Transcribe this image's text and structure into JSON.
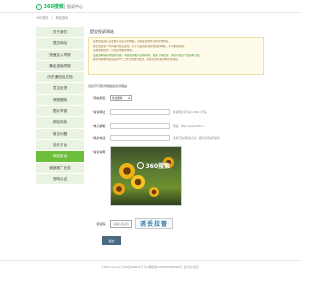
{
  "header": {
    "logo_text": "360搜索",
    "subtitle": "投诉中心"
  },
  "breadcrumb": [
    "360首页",
    "网站投诉"
  ],
  "sidebar": {
    "items": [
      {
        "label": "关于我们",
        "active": false
      },
      {
        "label": "提交网址",
        "active": false
      },
      {
        "label": "快速加入举报",
        "active": false
      },
      {
        "label": "暴走漫画举报",
        "active": false
      },
      {
        "label": "历史通知及文档",
        "active": false
      },
      {
        "label": "意见反馈",
        "active": false
      },
      {
        "label": "快照删除",
        "active": false
      },
      {
        "label": "图片举报",
        "active": false
      },
      {
        "label": "网站体检",
        "active": false
      },
      {
        "label": "常见问题",
        "active": false
      },
      {
        "label": "站长平台",
        "active": false
      },
      {
        "label": "网站投诉",
        "active": true
      },
      {
        "label": "营销推广业务",
        "active": false
      },
      {
        "label": "官网认证",
        "active": false
      }
    ]
  },
  "main": {
    "title": "提交投诉网站",
    "notice": [
      "如果您发现有违法或不良信息的网站，请在此提交并注明具体原因。",
      "我们会在第一时间进行核实处理，对于违反国家法律法规的网站，予以删除处理。",
      "请勿重复提交，以免影响处理效率。",
      "如发现网站存在侵权问题，请您提供相关证明材料。如需了解更多，请访问知识产权保护页面。",
      "我们将在收到投诉后的3个工作日内进行处理，处理结果将通过邮件通知您。"
    ],
    "form_note": "请您尽可能详细描述投诉理由",
    "form": {
      "type_label": "网站类型：",
      "type_value": "非法赌博",
      "url_label": "投诉网址：",
      "url_hint": "投诉网址请务必以http://开头",
      "email_label": "电子邮箱：",
      "email_hint": "例如：http://www.360.cn",
      "contact_label": "联系电话：",
      "contact_hint": "请填写您的联系方式，我们会尽快回复您",
      "message_label": "投诉说明：",
      "captcha_label": "验证码：",
      "captcha_placeholder": "请输入验证码",
      "captcha_text": "诱丢拉督",
      "submit_label": "提交"
    }
  },
  "footer": {
    "text": "©2021 so.com  京ICP证080047号  京公网安备11000002000006号  北京市公安局"
  },
  "colors": {
    "brand_green": "#19b955",
    "sidebar_active": "#6cbf3a",
    "sidebar_bg": "#e9f3e1",
    "notice_bg": "#fffbea",
    "submit_bg": "#4a6a82"
  }
}
